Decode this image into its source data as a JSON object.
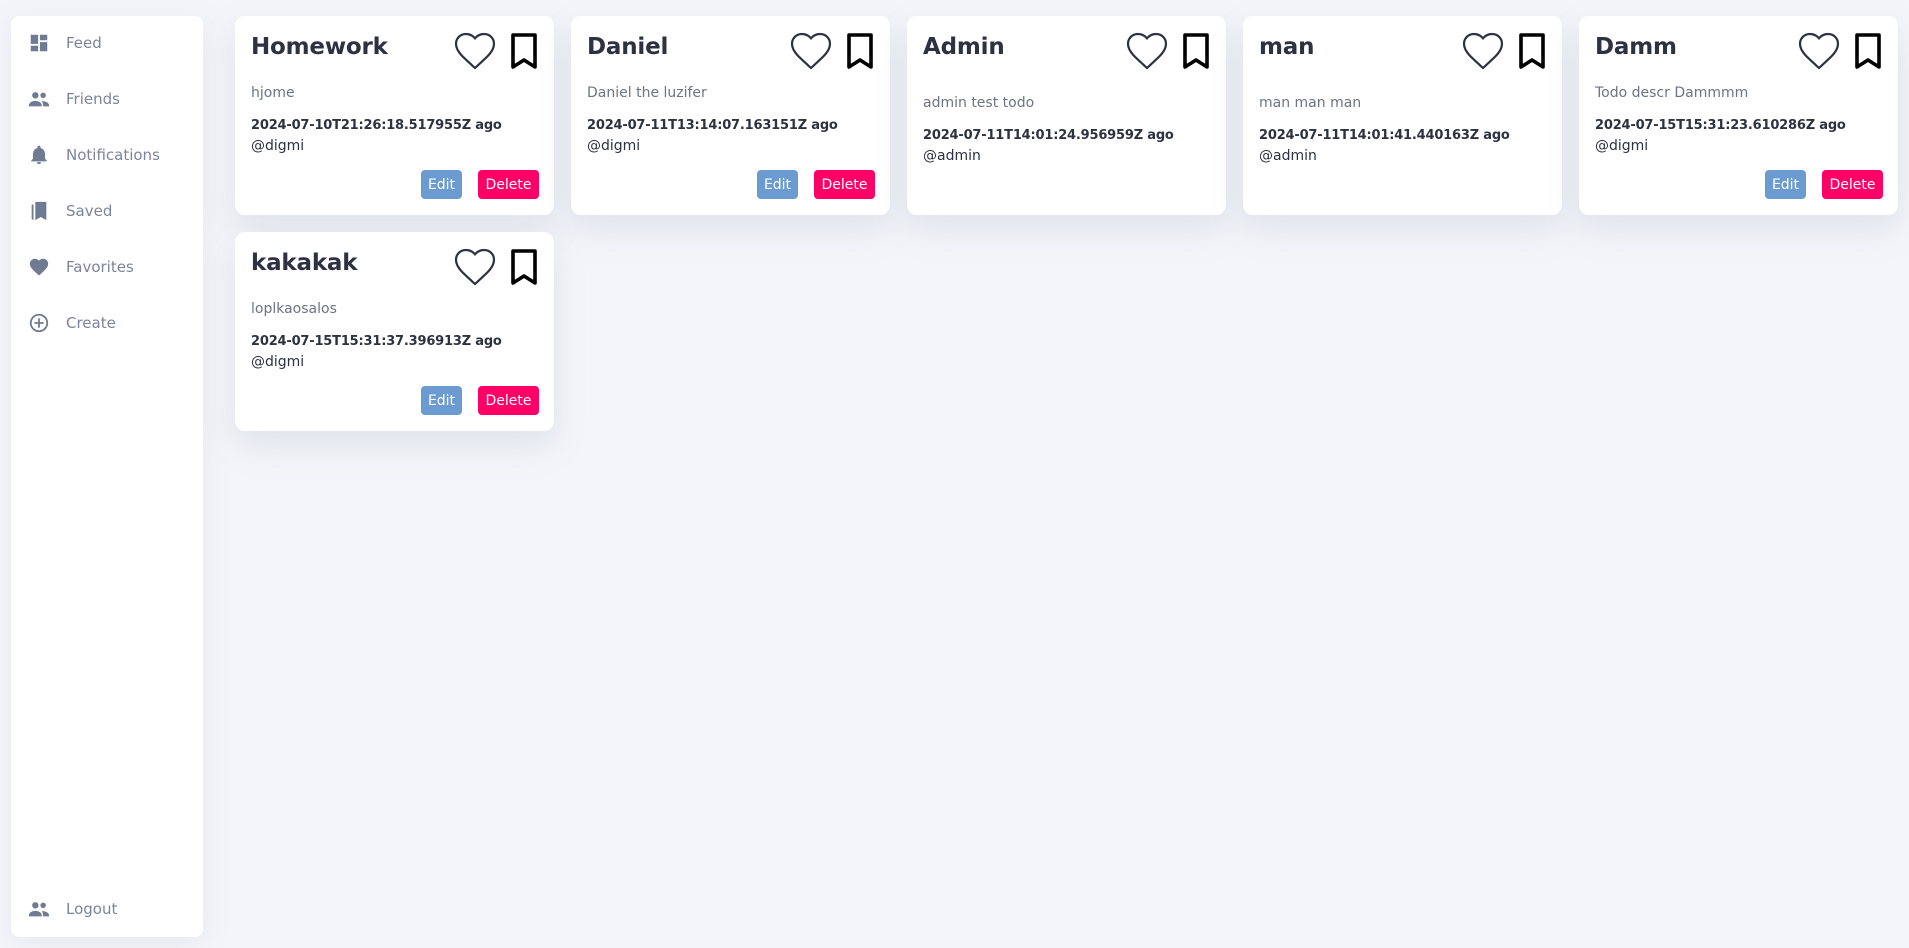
{
  "sidebar": {
    "items": [
      {
        "label": "Feed",
        "icon": "dashboard-icon"
      },
      {
        "label": "Friends",
        "icon": "people-icon"
      },
      {
        "label": "Notifications",
        "icon": "bell-icon"
      },
      {
        "label": "Saved",
        "icon": "bookmarks-icon"
      },
      {
        "label": "Favorites",
        "icon": "heart-icon"
      },
      {
        "label": "Create",
        "icon": "plus-circle-icon"
      }
    ],
    "logout": {
      "label": "Logout",
      "icon": "people-icon"
    }
  },
  "colors": {
    "edit": "#6b9bd0",
    "delete": "#ff0066",
    "background": "#f4f5f9"
  },
  "cards": [
    {
      "title": "Homework",
      "description": "hjome",
      "date": "2024-07-10T21:26:18.517955Z ago",
      "user": "@digmi",
      "has_actions": true,
      "edit_label": "Edit",
      "delete_label": "Delete"
    },
    {
      "title": "Daniel",
      "description": "Daniel the luzifer",
      "date": "2024-07-11T13:14:07.163151Z ago",
      "user": "@digmi",
      "has_actions": true,
      "edit_label": "Edit",
      "delete_label": "Delete"
    },
    {
      "title": "Admin",
      "description": "admin test todo",
      "date": "2024-07-11T14:01:24.956959Z ago",
      "user": "@admin",
      "has_actions": false
    },
    {
      "title": "man",
      "description": "man man man",
      "date": "2024-07-11T14:01:41.440163Z ago",
      "user": "@admin",
      "has_actions": false
    },
    {
      "title": "Damm",
      "description": "Todo descr Dammmm",
      "date": "2024-07-15T15:31:23.610286Z ago",
      "user": "@digmi",
      "has_actions": true,
      "edit_label": "Edit",
      "delete_label": "Delete"
    },
    {
      "title": "kakakak",
      "description": "loplkaosalos",
      "date": "2024-07-15T15:31:37.396913Z ago",
      "user": "@digmi",
      "has_actions": true,
      "edit_label": "Edit",
      "delete_label": "Delete"
    }
  ]
}
